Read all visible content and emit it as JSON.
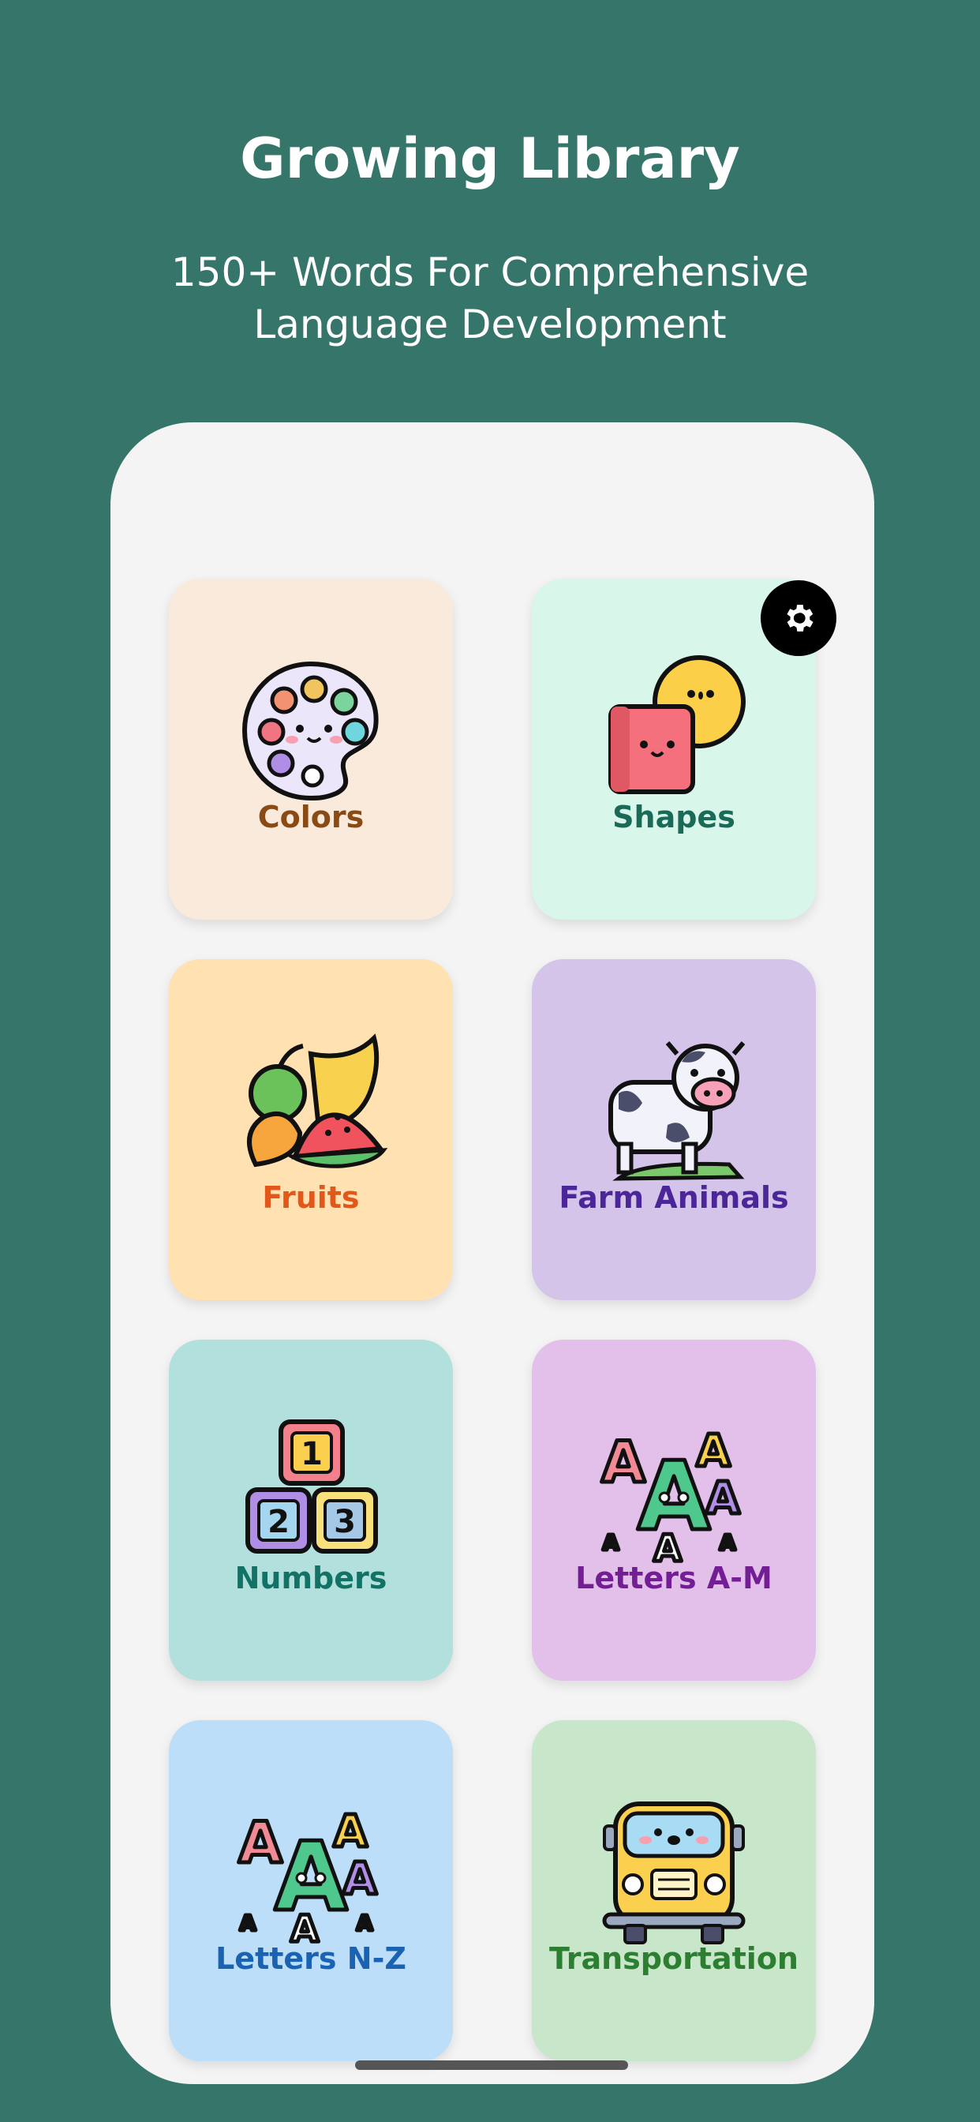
{
  "header": {
    "title": "Growing Library",
    "subtitle_line1": "150+ Words For Comprehensive",
    "subtitle_line2": "Language Development"
  },
  "categories": [
    {
      "label": "Colors",
      "bg": "#faeadc",
      "text_color": "#8a4a14",
      "icon": "palette-icon"
    },
    {
      "label": "Shapes",
      "bg": "#d8f6ea",
      "text_color": "#1b6a58",
      "icon": "shapes-icon"
    },
    {
      "label": "Fruits",
      "bg": "#ffe1b2",
      "text_color": "#e2571a",
      "icon": "fruits-icon"
    },
    {
      "label": "Farm Animals",
      "bg": "#d4c4ea",
      "text_color": "#4b2698",
      "icon": "cow-icon"
    },
    {
      "label": "Numbers",
      "bg": "#b2e0dc",
      "text_color": "#127266",
      "icon": "number-blocks-icon"
    },
    {
      "label": "Letters A-M",
      "bg": "#e2c0ea",
      "text_color": "#741e96",
      "icon": "letters-icon"
    },
    {
      "label": "Letters N-Z",
      "bg": "#bcdef8",
      "text_color": "#1a62b2",
      "icon": "letters-icon"
    },
    {
      "label": "Transportation",
      "bg": "#c8e6ca",
      "text_color": "#2c7e30",
      "icon": "bus-icon"
    }
  ],
  "settings": {
    "icon": "gear-icon"
  }
}
